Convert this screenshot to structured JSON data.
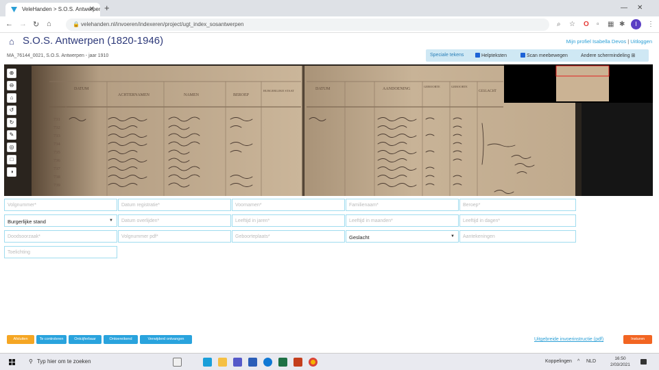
{
  "browser": {
    "tab_title": "VeleHanden > S.O.S. Antwerpen",
    "url": "velehanden.nl/invoeren/indexeren/project/ugt_index_sosantwerpen"
  },
  "header": {
    "title": "S.O.S. Antwerpen (1820-1946)",
    "profile_link": "Mijn profiel",
    "user_name": "Isabella Devos",
    "logout": "Uitloggen",
    "scan_info": "MA_76144_0021, S.O.S. Antwerpen - jaar 1910"
  },
  "options": {
    "special_chars": "Speciale tekens",
    "help_texts": "Helpteksten",
    "scan_follow": "Scan meebewegen",
    "other_layout": "Andere schermindeling"
  },
  "viewer": {
    "ledger_headers_left": [
      "DATUM",
      "ACHTERNAMEN",
      "NAMEN",
      "BEROEP",
      "BURGERLIJKE STAAT"
    ],
    "ledger_headers_right": [
      "DATUM",
      "AANDOENING",
      "GEBOORTE",
      "GEBOORTE",
      "GESLACHT"
    ],
    "row_numbers": [
      "731",
      "732",
      "733",
      "734",
      "735",
      "736",
      "737",
      "738",
      "739"
    ]
  },
  "form": {
    "row1": [
      "Volgnummer*",
      "Datum registratie*",
      "Voornamen*",
      "Familienaam*",
      "Beroep*"
    ],
    "row2": [
      "Burgerlijke stand",
      "Datum overlijden*",
      "Leeftijd in jaren*",
      "Leeftijd in maanden*",
      "Leeftijd in dagen*"
    ],
    "row3": [
      "Doodsoorzaak*",
      "Volgnummer pdf*",
      "Geboorteplaats*",
      "Geslacht",
      "Aantekeningen"
    ],
    "row4": [
      "Toelichting"
    ]
  },
  "buttons": {
    "b1": "Afsluiten",
    "b2": "Te controleren",
    "b3": "Ontcijferbaar",
    "b4": "Ontoereikend",
    "b5": "Verwijderd ontvangen",
    "pdf": "Uitgebreide invoerinstructie (pdf)",
    "submit": "Insturen"
  },
  "taskbar": {
    "search": "Typ hier om te zoeken",
    "connections": "Koppelingen",
    "lang": "NLD",
    "time": "16:50",
    "date": "2/03/2021"
  }
}
